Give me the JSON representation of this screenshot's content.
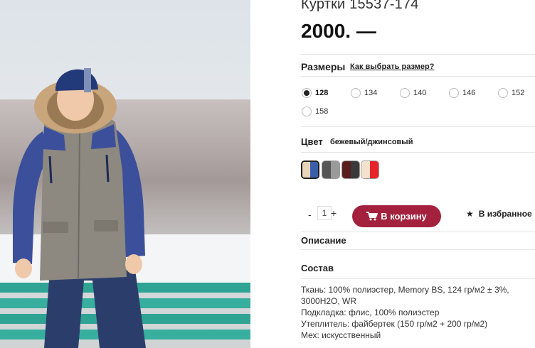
{
  "product": {
    "title": "Куртки 15537-174",
    "price": "2000. —",
    "image_alt": "Мальчик в зимней куртке"
  },
  "sizes": {
    "label": "Размеры",
    "help_link": "Как выбрать размер?",
    "options": [
      {
        "label": "128",
        "selected": true
      },
      {
        "label": "134",
        "selected": false
      },
      {
        "label": "140",
        "selected": false
      },
      {
        "label": "146",
        "selected": false
      },
      {
        "label": "152",
        "selected": false
      },
      {
        "label": "158",
        "selected": false
      }
    ]
  },
  "color": {
    "label": "Цвет",
    "value": "бежевый/джинсовый",
    "swatches": [
      {
        "left": "#e8d4b8",
        "right": "#3a5fa8",
        "active": true
      },
      {
        "left": "#555555",
        "right": "#9a9a9a",
        "active": false
      },
      {
        "left": "#5a1e1e",
        "right": "#3a3a3a",
        "active": false
      },
      {
        "left": "#f5e2cc",
        "right": "#e8232a",
        "active": false
      }
    ]
  },
  "quantity": {
    "minus": "-",
    "value": "1",
    "plus": "+"
  },
  "actions": {
    "add_to_cart": "В корзину",
    "favorite": "В избранное"
  },
  "sections": {
    "description": "Описание",
    "composition": "Состав"
  },
  "composition_lines": [
    "Ткань: 100% полиэстер, Memory BS, 124 гр/м2 ± 3%,",
    "3000H2O, WR",
    "Подкладка: флис, 100% полиэстер",
    "Утеплитель: файбертек (150 гр/м2 + 200 гр/м2)",
    "Мех: искусственный"
  ],
  "colors": {
    "accent": "#a3213d",
    "jacket_body": "#8d8880",
    "jacket_sleeves": "#3c4f9a",
    "bench": "#2fa494"
  }
}
